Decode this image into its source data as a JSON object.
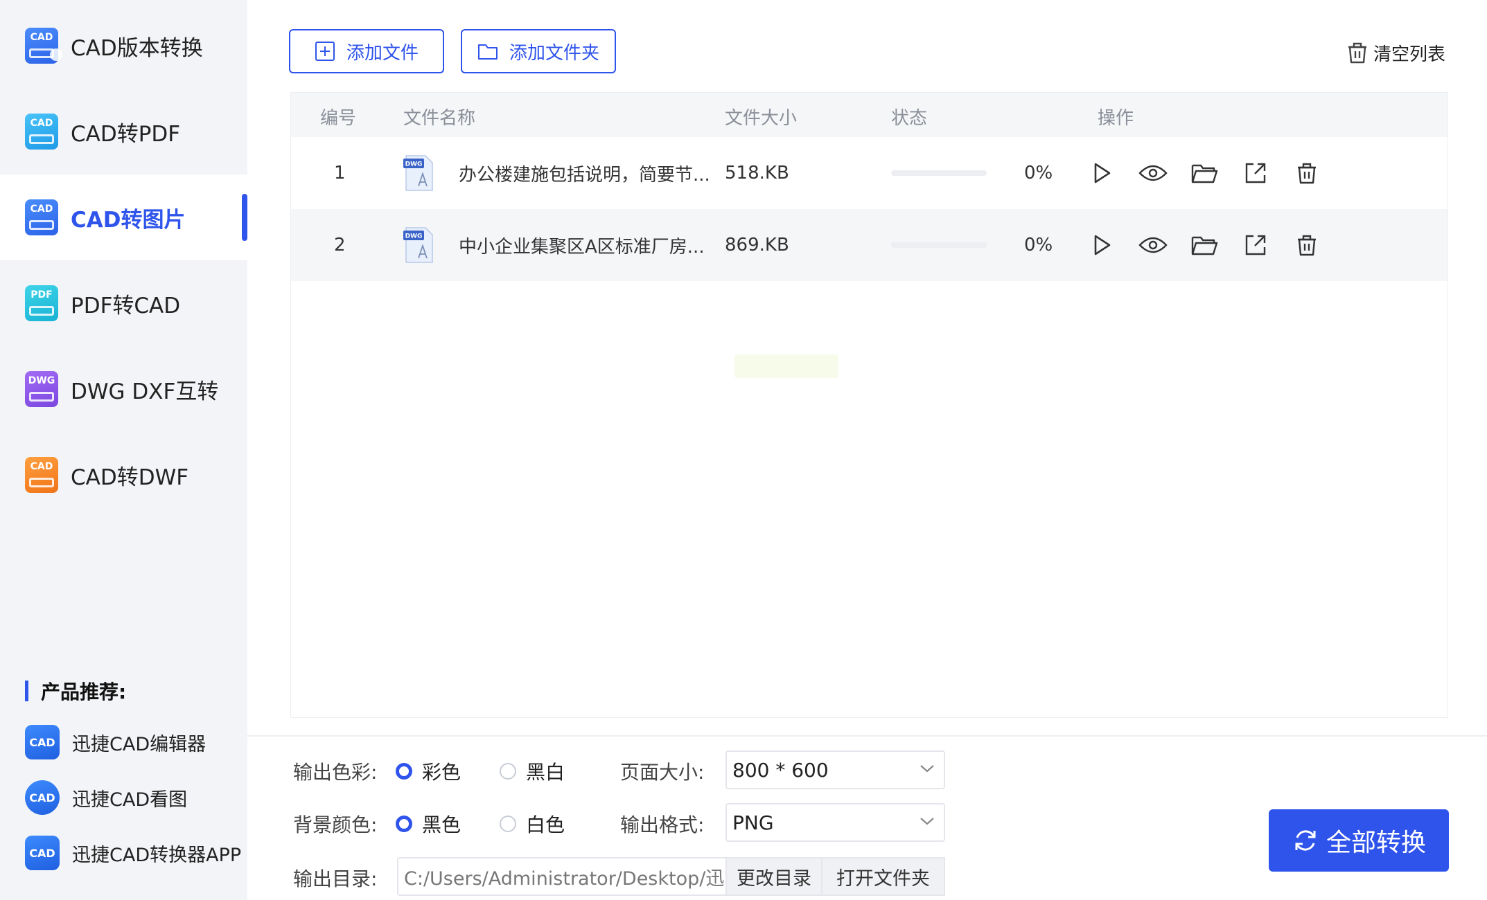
{
  "sidebar": {
    "items": [
      {
        "label": "CAD版本转换",
        "icon": "cad-version-icon",
        "icon_text": "CAD"
      },
      {
        "label": "CAD转PDF",
        "icon": "cad-to-pdf-icon",
        "icon_text": "CAD"
      },
      {
        "label": "CAD转图片",
        "icon": "cad-to-image-icon",
        "icon_text": "CAD",
        "active": true
      },
      {
        "label": "PDF转CAD",
        "icon": "pdf-to-cad-icon",
        "icon_text": "PDF"
      },
      {
        "label": "DWG DXF互转",
        "icon": "dwg-dxf-icon",
        "icon_text": "DWG"
      },
      {
        "label": "CAD转DWF",
        "icon": "cad-to-dwf-icon",
        "icon_text": "CAD"
      }
    ],
    "recommend_title": "产品推荐:",
    "recommend": [
      {
        "label": "迅捷CAD编辑器",
        "icon": "cad-editor-icon",
        "icon_text": "CAD"
      },
      {
        "label": "迅捷CAD看图",
        "icon": "cad-viewer-icon",
        "icon_text": "CAD"
      },
      {
        "label": "迅捷CAD转换器APP",
        "icon": "cad-converter-app-icon",
        "icon_text": "CAD"
      }
    ]
  },
  "toolbar": {
    "add_file": "添加文件",
    "add_folder": "添加文件夹",
    "clear_list": "清空列表"
  },
  "table": {
    "headers": {
      "index": "编号",
      "name": "文件名称",
      "size": "文件大小",
      "status": "状态",
      "actions": "操作"
    },
    "rows": [
      {
        "index": "1",
        "name": "办公楼建施包括说明，简要节...",
        "size": "518.KB",
        "progress": "0%",
        "file_icon_text": "DWG"
      },
      {
        "index": "2",
        "name": "中小企业集聚区A区标准厂房...",
        "size": "869.KB",
        "progress": "0%",
        "file_icon_text": "DWG"
      }
    ]
  },
  "settings": {
    "color_label": "输出色彩:",
    "color_options": [
      "彩色",
      "黑白"
    ],
    "color_selected": "彩色",
    "bg_label": "背景颜色:",
    "bg_options": [
      "黑色",
      "白色"
    ],
    "bg_selected": "黑色",
    "page_size_label": "页面大小:",
    "page_size_value": "800 * 600",
    "format_label": "输出格式:",
    "format_value": "PNG",
    "output_dir_label": "输出目录:",
    "output_dir_value": "C:/Users/Administrator/Desktop/迅...",
    "change_dir": "更改目录",
    "open_folder": "打开文件夹",
    "convert_all": "全部转换"
  },
  "colors": {
    "accent": "#2f54eb",
    "sidebar_bg": "#f3f4f7"
  }
}
